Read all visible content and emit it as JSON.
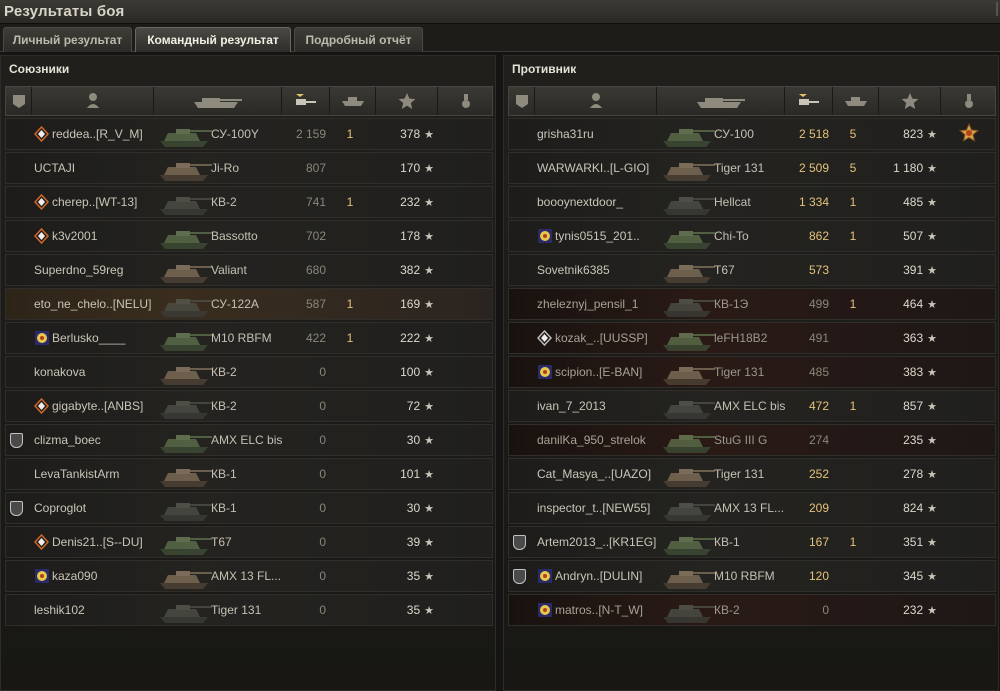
{
  "window": {
    "title": "Результаты боя"
  },
  "tabs": [
    {
      "label": "Личный результат",
      "active": false
    },
    {
      "label": "Командный результат",
      "active": true
    },
    {
      "label": "Подробный отчёт",
      "active": false
    }
  ],
  "columns_icons": [
    "platoon-icon",
    "player-icon",
    "tank-icon",
    "damage-icon",
    "kills-icon",
    "xp-star-icon",
    "medal-icon"
  ],
  "allies": {
    "title": "Союзники",
    "rows": [
      {
        "name": "reddea..[R_V_M]",
        "tank": "СУ-100Y",
        "damage": "2 159",
        "kills": "1",
        "xp": "378",
        "badge": "diamond",
        "style": ""
      },
      {
        "name": "UCTAJI",
        "tank": "Ji-Ro",
        "damage": "807",
        "kills": "",
        "xp": "170",
        "badge": "",
        "style": ""
      },
      {
        "name": "cherep..[WT-13]",
        "tank": "КВ-2",
        "damage": "741",
        "kills": "1",
        "xp": "232",
        "badge": "diamond",
        "style": ""
      },
      {
        "name": "k3v2001",
        "tank": "Bassotto",
        "damage": "702",
        "kills": "",
        "xp": "178",
        "badge": "diamond",
        "style": ""
      },
      {
        "name": "Superdno_59reg",
        "tank": "Valiant",
        "damage": "680",
        "kills": "",
        "xp": "382",
        "badge": "",
        "style": ""
      },
      {
        "name": "eto_ne_chelo..[NELU]",
        "tank": "СУ-122А",
        "damage": "587",
        "kills": "1",
        "xp": "169",
        "badge": "",
        "style": "hl"
      },
      {
        "name": "Berlusko____",
        "tank": "M10 RBFM",
        "damage": "422",
        "kills": "1",
        "xp": "222",
        "badge": "clan",
        "style": ""
      },
      {
        "name": "konakova",
        "tank": "КВ-2",
        "damage": "0",
        "kills": "",
        "xp": "100",
        "badge": "",
        "style": ""
      },
      {
        "name": "gigabyte..[ANBS]",
        "tank": "КВ-2",
        "damage": "0",
        "kills": "",
        "xp": "72",
        "badge": "diamond",
        "style": ""
      },
      {
        "name": "clizma_boec",
        "tank": "AMX ELC bis",
        "damage": "0",
        "kills": "",
        "xp": "30",
        "badge": "shield",
        "style": ""
      },
      {
        "name": "LevaTankistArm",
        "tank": "КВ-1",
        "damage": "0",
        "kills": "",
        "xp": "101",
        "badge": "",
        "style": ""
      },
      {
        "name": "Coproglot",
        "tank": "КВ-1",
        "damage": "0",
        "kills": "",
        "xp": "30",
        "badge": "shield",
        "style": ""
      },
      {
        "name": "Denis21..[S--DU]",
        "tank": "T67",
        "damage": "0",
        "kills": "",
        "xp": "39",
        "badge": "diamond",
        "style": ""
      },
      {
        "name": "kaza090",
        "tank": "AMX 13 FL...",
        "damage": "0",
        "kills": "",
        "xp": "35",
        "badge": "clan",
        "style": ""
      },
      {
        "name": "leshik102",
        "tank": "Tiger 131",
        "damage": "0",
        "kills": "",
        "xp": "35",
        "badge": "",
        "style": ""
      }
    ]
  },
  "enemies": {
    "title": "Противник",
    "rows": [
      {
        "name": "grisha31ru",
        "tank": "СУ-100",
        "damage": "2 518",
        "kills": "5",
        "xp": "823",
        "badge": "",
        "style": "",
        "medal": true
      },
      {
        "name": "WARWARKI..[L-GIO]",
        "tank": "Tiger 131",
        "damage": "2 509",
        "kills": "5",
        "xp": "1 180",
        "badge": "",
        "style": ""
      },
      {
        "name": "boooynextdoor_",
        "tank": "Hellcat",
        "damage": "1 334",
        "kills": "1",
        "xp": "485",
        "badge": "",
        "style": ""
      },
      {
        "name": "tynis0515_201..",
        "tank": "Chi-To",
        "damage": "862",
        "kills": "1",
        "xp": "507",
        "badge": "clan",
        "style": ""
      },
      {
        "name": "Sovetnik6385",
        "tank": "T67",
        "damage": "573",
        "kills": "",
        "xp": "391",
        "badge": "",
        "style": ""
      },
      {
        "name": "zheleznyj_pensil_1",
        "tank": "КВ-1Э",
        "damage": "499",
        "kills": "1",
        "xp": "464",
        "badge": "",
        "style": "dark"
      },
      {
        "name": "kozak_..[UUSSP]",
        "tank": "leFH18B2",
        "damage": "491",
        "kills": "",
        "xp": "363",
        "badge": "diamond-w",
        "style": "dark"
      },
      {
        "name": "scipion..[E-BAN]",
        "tank": "Tiger 131",
        "damage": "485",
        "kills": "",
        "xp": "383",
        "badge": "clan",
        "style": "dark"
      },
      {
        "name": "ivan_7_2013",
        "tank": "AMX ELC bis",
        "damage": "472",
        "kills": "1",
        "xp": "857",
        "badge": "",
        "style": ""
      },
      {
        "name": "danilKa_950_strelok",
        "tank": "StuG III G",
        "damage": "274",
        "kills": "",
        "xp": "235",
        "badge": "",
        "style": "dark"
      },
      {
        "name": "Cat_Masya_..[UAZO]",
        "tank": "Tiger 131",
        "damage": "252",
        "kills": "",
        "xp": "278",
        "badge": "",
        "style": ""
      },
      {
        "name": "inspector_t..[NEW55]",
        "tank": "AMX 13 FL...",
        "damage": "209",
        "kills": "",
        "xp": "824",
        "badge": "",
        "style": ""
      },
      {
        "name": "Artem2013_..[KR1EG]",
        "tank": "КВ-1",
        "damage": "167",
        "kills": "1",
        "xp": "351",
        "badge": "shield",
        "style": ""
      },
      {
        "name": "Andryn..[DULIN]",
        "tank": "M10 RBFM",
        "damage": "120",
        "kills": "",
        "xp": "345",
        "badge": "shield-clan",
        "style": ""
      },
      {
        "name": "matros..[N-T_W]",
        "tank": "КВ-2",
        "damage": "0",
        "kills": "",
        "xp": "232",
        "badge": "clan-w",
        "style": "dark"
      }
    ]
  },
  "star_glyph": "★"
}
